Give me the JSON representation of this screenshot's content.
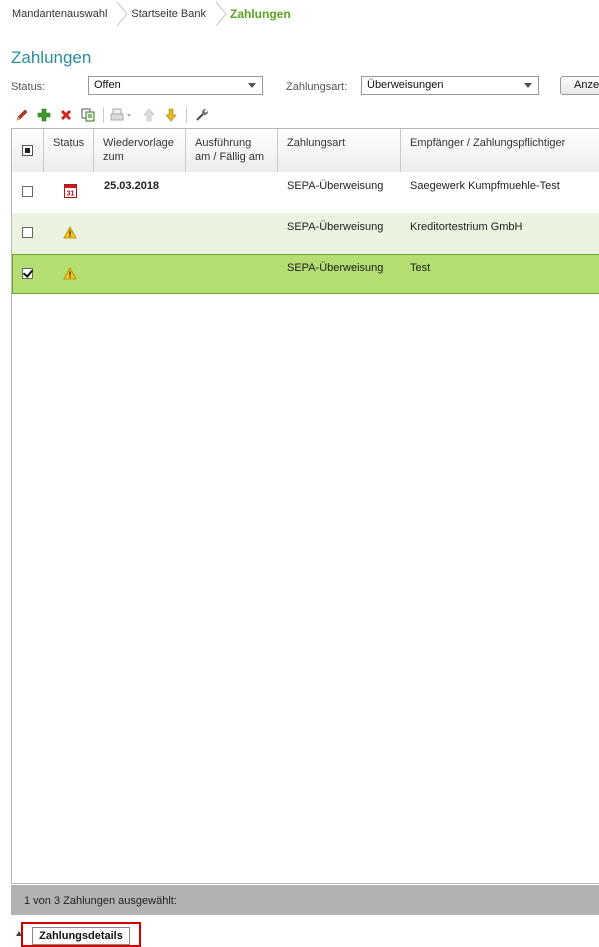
{
  "breadcrumb": {
    "items": [
      "Mandantenauswahl",
      "Startseite Bank",
      "Zahlungen"
    ]
  },
  "page_title": "Zahlungen",
  "filters": {
    "status_label": "Status:",
    "status_value": "Offen",
    "zahlungsart_label": "Zahlungsart:",
    "zahlungsart_value": "Überweisungen",
    "anzeigen_label": "Anzei"
  },
  "toolbar": {
    "icons": [
      "edit-icon",
      "add-icon",
      "delete-icon",
      "copy-icon",
      "print-icon",
      "move-up-icon",
      "move-down-icon",
      "settings-icon"
    ]
  },
  "table": {
    "headers": {
      "status": "Status",
      "wiedervorlage_1": "Wiedervorlage",
      "wiedervorlage_2": "zum",
      "ausfuehrung_1": "Ausführung",
      "ausfuehrung_2": "am / Fällig am",
      "zahlungsart": "Zahlungsart",
      "empfaenger": "Empfänger / Zahlungspflichtiger"
    },
    "rows": [
      {
        "checked": false,
        "status_icon": "calendar-icon",
        "calendar_day": "31",
        "wiedervorlage": "25.03.2018",
        "ausfuehrung": "",
        "zahlungsart": "SEPA-Überweisung",
        "empfaenger": "Saegewerk Kumpfmuehle-Test"
      },
      {
        "checked": false,
        "status_icon": "warning-icon",
        "wiedervorlage": "",
        "ausfuehrung": "",
        "zahlungsart": "SEPA-Überweisung",
        "empfaenger": "Kreditortestrium GmbH"
      },
      {
        "checked": true,
        "status_icon": "warning-icon",
        "wiedervorlage": "",
        "ausfuehrung": "",
        "zahlungsart": "SEPA-Überweisung",
        "empfaenger": "Test"
      }
    ]
  },
  "statusbar": {
    "text": "1 von 3 Zahlungen ausgewählt:"
  },
  "bottom_tab": {
    "label": "Zahlungsdetails"
  },
  "colors": {
    "title": "#2a8d9d",
    "active_crumb": "#5aa51f",
    "selected_row": "#b4dd72",
    "alt_row": "#eaf3df",
    "highlight": "#d40000"
  }
}
